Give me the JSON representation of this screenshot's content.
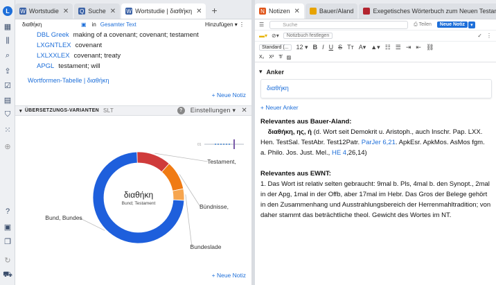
{
  "left_tabs": [
    {
      "label": "Wortstudie",
      "color": "#3b62a6"
    },
    {
      "label": "Suche",
      "color": "#3b62a6"
    },
    {
      "label": "Wortstudie | διαθήκη",
      "color": "#3b62a6"
    }
  ],
  "right_tabs": [
    {
      "label": "Notizen",
      "color": "#e0561b"
    },
    {
      "label": "Bauer/Aland",
      "color": "#e7a300"
    },
    {
      "label": "Exegetisches Wörterbuch zum Neuen Testament",
      "color": "#b3242f"
    }
  ],
  "search": {
    "query": "διαθήκη",
    "in_label": "in",
    "scope": "Gesamter Text",
    "add_label": "Hinzufügen"
  },
  "results": [
    {
      "key": "DBL Greek",
      "text": "making of a covenant; covenant; testament"
    },
    {
      "key": "LXGNTLEX",
      "text": "covenant"
    },
    {
      "key": "LXLXXLEX",
      "text": "covenant; treaty"
    },
    {
      "key": "APGL",
      "text": "testament; will"
    }
  ],
  "forms_link": "Wortformen-Tabelle  |  διαθήκη",
  "new_note": "+ Neue Notiz",
  "translations": {
    "title": "ÜBERSETZUNGS-VARIANTEN",
    "abbr": "SLT",
    "settings": "Einstellungen"
  },
  "chart_data": {
    "type": "pie",
    "center_title": "διαθήκη",
    "center_subtitle": "Bund; Testament",
    "slices": [
      {
        "label": "Bund, Bundes",
        "value": 72,
        "color": "#1e5fdc"
      },
      {
        "label": "Testament,",
        "value": 12,
        "color": "#cf3b3b"
      },
      {
        "label": "Bündnisse,",
        "value": 10,
        "color": "#f07b14"
      },
      {
        "label": "Bundeslade",
        "value": 4,
        "color": "#f6a54f"
      }
    ]
  },
  "notes": {
    "search_placeholder": "Suche",
    "share": "Teilen",
    "new_note_btn": "Neue Notiz",
    "notebook_fix": "Notizbuch festlegen",
    "style_select": "Standard (...",
    "size_select": "12",
    "anchor_heading": "Anker",
    "anchor_value": "διαθήκη",
    "new_anchor": "+ Neuer Anker",
    "ba_heading": "Relevantes aus Bauer-Aland:",
    "ba_lemma": "διαθήκη, ης, ἡ",
    "ba_text1": " (d. Wort seit Demokrit u. Aristoph., auch Inschr. Pap. LXX. Hen. TestSal. TestAbr. Test12Patr. ",
    "ba_link1": "ParJer 6,21",
    "ba_text2": ". ApkEsr. ApkMos. AsMos fgm. a. Philo. Jos. Just. Mel., ",
    "ba_link2": "HE 4",
    "ba_text3": ",26,14)",
    "ewnt_heading": "Relevantes aus EWNT:",
    "ewnt_text": "1. Das Wort ist relativ selten gebraucht: 9mal b. Pls, 4mal b. den Synopt., 2mal in der Apg, 1mal in der Offb, aber 17mal im Hebr. Das Gros der Belege gehört in den Zusammenhang und Ausstrahlungsbereich der Herrenmahltradition; von daher stammt das beträchtliche theol. Gewicht des Wortes im NT."
  }
}
